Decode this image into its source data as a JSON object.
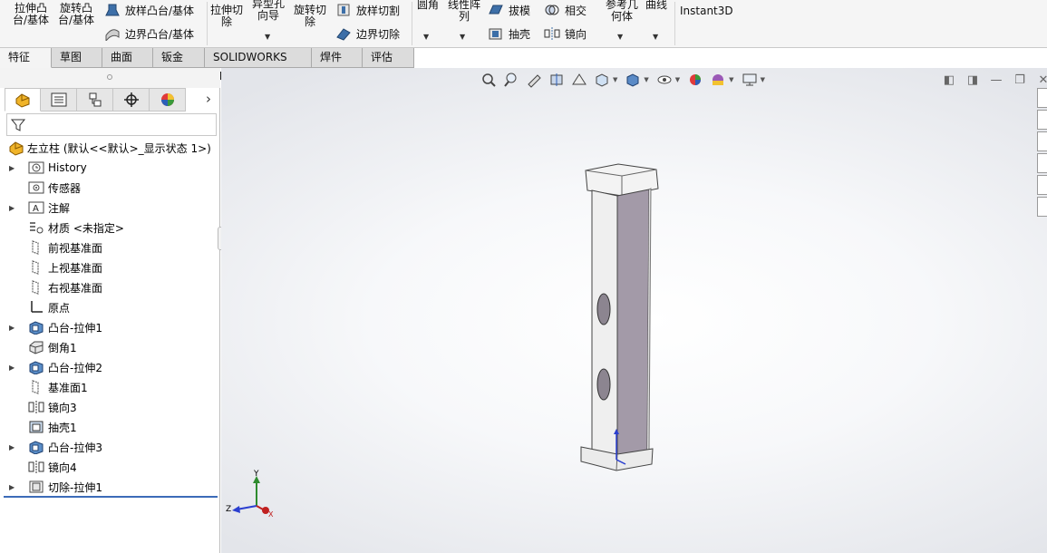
{
  "ribbon": {
    "extrude_boss": "拉伸凸\n台/基体",
    "revolve_boss": "旋转凸\n台/基体",
    "loft_boss": "放样凸台/基体",
    "boundary_boss": "边界凸台/基体",
    "extrude_cut": "拉伸切\n除",
    "hole_wizard": "异型孔\n向导",
    "revolve_cut": "旋转切\n除",
    "loft_cut": "放样切割",
    "boundary_cut": "边界切除",
    "fillet": "圆角",
    "linear_pattern": "线性阵\n列",
    "draft": "拔模",
    "shell": "抽壳",
    "intersect": "相交",
    "mirror": "镜向",
    "ref_geometry": "参考几\n何体",
    "curves": "曲线",
    "instant3d": "Instant3D"
  },
  "tabs": [
    {
      "label": "特征",
      "active": true
    },
    {
      "label": "草图",
      "active": false
    },
    {
      "label": "曲面",
      "active": false
    },
    {
      "label": "钣金",
      "active": false
    },
    {
      "label": "SOLIDWORKS MBD",
      "active": false
    },
    {
      "label": "焊件(D)",
      "active": false
    },
    {
      "label": "评估",
      "active": false
    }
  ],
  "tree": {
    "root": "左立柱  (默认<<默认>_显示状态 1>)",
    "items": [
      {
        "label": "History",
        "icon": "history-icon",
        "expandable": true
      },
      {
        "label": "传感器",
        "icon": "sensor-icon",
        "expandable": false
      },
      {
        "label": "注解",
        "icon": "annotation-icon",
        "expandable": true
      },
      {
        "label": "材质 <未指定>",
        "icon": "material-icon",
        "expandable": false
      },
      {
        "label": "前视基准面",
        "icon": "plane-icon",
        "expandable": false
      },
      {
        "label": "上视基准面",
        "icon": "plane-icon",
        "expandable": false
      },
      {
        "label": "右视基准面",
        "icon": "plane-icon",
        "expandable": false
      },
      {
        "label": "原点",
        "icon": "origin-icon",
        "expandable": false
      },
      {
        "label": "凸台-拉伸1",
        "icon": "boss-extrude-icon",
        "expandable": true
      },
      {
        "label": "倒角1",
        "icon": "chamfer-icon",
        "expandable": false
      },
      {
        "label": "凸台-拉伸2",
        "icon": "boss-extrude-icon",
        "expandable": true
      },
      {
        "label": "基准面1",
        "icon": "plane-icon",
        "expandable": false
      },
      {
        "label": "镜向3",
        "icon": "mirror-icon",
        "expandable": false
      },
      {
        "label": "抽壳1",
        "icon": "shell-icon",
        "expandable": false
      },
      {
        "label": "凸台-拉伸3",
        "icon": "boss-extrude-icon",
        "expandable": true
      },
      {
        "label": "镜向4",
        "icon": "mirror-icon",
        "expandable": false
      },
      {
        "label": "切除-拉伸1",
        "icon": "cut-extrude-icon",
        "expandable": true
      }
    ]
  },
  "triad": {
    "x": "X",
    "y": "Y",
    "z": "Z"
  },
  "colors": {
    "accent": "#3c6bb8",
    "model_face": "#eeeeee",
    "model_side": "#a39aa8"
  }
}
